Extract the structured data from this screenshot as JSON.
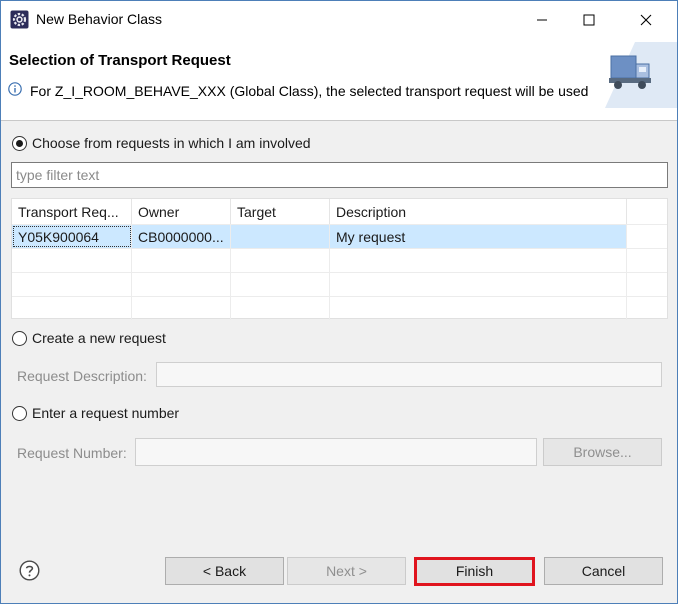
{
  "window": {
    "title": "New Behavior Class",
    "icon": "eclipse-gear-icon"
  },
  "header": {
    "title": "Selection of Transport Request",
    "message": "For Z_I_ROOM_BEHAVE_XXX (Global Class), the selected transport request will be used",
    "info_icon": "info-icon",
    "banner_icon": "truck-icon"
  },
  "options": {
    "involved_label": "Choose from requests in which I am involved",
    "involved_selected": true,
    "new_request_label": "Create a new request",
    "enter_number_label": "Enter a request number"
  },
  "filter": {
    "placeholder": "type filter text",
    "value": ""
  },
  "table": {
    "columns": [
      "Transport Req...",
      "Owner",
      "Target",
      "Description"
    ],
    "rows": [
      {
        "transport": "Y05K900064",
        "owner": "CB0000000...",
        "target": "",
        "description": "My request",
        "selected": true
      }
    ]
  },
  "new_request": {
    "description_label": "Request Description:",
    "description_value": ""
  },
  "enter_number": {
    "number_label": "Request Number:",
    "number_value": "",
    "browse_label": "Browse..."
  },
  "buttons": {
    "back": "< Back",
    "next": "Next >",
    "finish": "Finish",
    "cancel": "Cancel"
  },
  "colors": {
    "selection": "#cce8ff",
    "highlight": "#e0141e",
    "focus": "#0078d7"
  }
}
